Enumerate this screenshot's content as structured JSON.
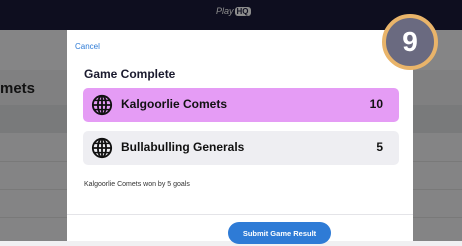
{
  "background": {
    "logo_text": "Play",
    "logo_badge": "HQ",
    "left_team_fragment": "mets"
  },
  "modal": {
    "cancel_label": "Cancel",
    "title": "Game Complete",
    "teams": [
      {
        "name": "Kalgoorlie Comets",
        "score": "10",
        "icon": "globe-icon",
        "highlight_color": "#e59cf5"
      },
      {
        "name": "Bullabulling Generals",
        "score": "5",
        "icon": "globe-icon",
        "highlight_color": "#eeeef2"
      }
    ],
    "result_text": "Kalgoorlie Comets won by 5 goals",
    "submit_label": "Submit Game Result"
  },
  "step_badge": {
    "number": "9",
    "ring_color": "#e9b46a",
    "fill_color": "#6a6a80"
  },
  "colors": {
    "accent": "#2e7bd6",
    "winner_highlight": "#e59cf5"
  }
}
